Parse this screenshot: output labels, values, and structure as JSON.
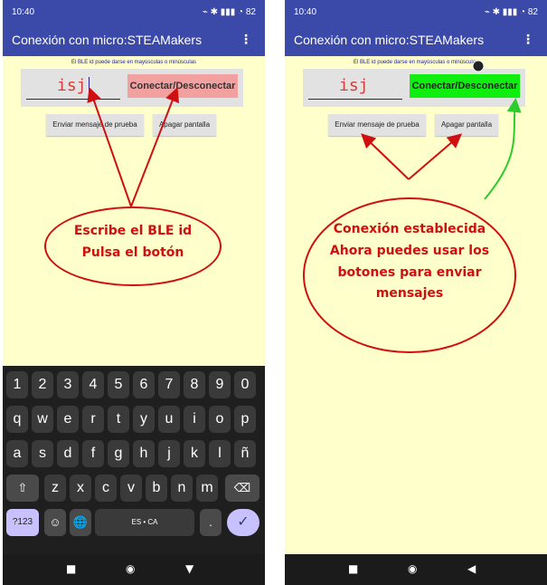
{
  "phones": [
    {
      "status": {
        "time": "10:40",
        "icons": "⌁ ✱ ▮▮▮ ◔ 82"
      },
      "appbar": {
        "title": "Conexión con micro:STEAMakers",
        "menu": "⋮"
      },
      "ble_hint": "El BLE id puede darse en mayúsculas o minúsculas",
      "ble_input_value": "isj",
      "connect_label": "Conectar/Desconectar",
      "test_button": "Enviar mensaje de prueba",
      "off_button": "Apagar pantalla",
      "annotation": {
        "line1": "Escribe el BLE id",
        "line2": "Pulsa el botón"
      },
      "keyboard": {
        "row1": [
          "1",
          "2",
          "3",
          "4",
          "5",
          "6",
          "7",
          "8",
          "9",
          "0"
        ],
        "row2": [
          "q",
          "w",
          "e",
          "r",
          "t",
          "y",
          "u",
          "i",
          "o",
          "p"
        ],
        "row3": [
          "a",
          "s",
          "d",
          "f",
          "g",
          "h",
          "j",
          "k",
          "l",
          "ñ"
        ],
        "row4": [
          "⇧",
          "z",
          "x",
          "c",
          "v",
          "b",
          "n",
          "m",
          "⌫"
        ],
        "row5": [
          "?123",
          "☺",
          "🌐",
          "ES • CA",
          ".",
          "✓"
        ]
      },
      "nav": [
        "■",
        "◉",
        "▼"
      ]
    },
    {
      "status": {
        "time": "10:40",
        "icons": "⌁ ✱ ▮▮▮ ◔ 82"
      },
      "appbar": {
        "title": "Conexión con micro:STEAMakers",
        "menu": "⋮"
      },
      "ble_hint": "El BLE id puede darse en mayúsculas o minúsculas",
      "ble_input_value": "isj",
      "connect_label": "Conectar/Desconectar",
      "test_button": "Enviar mensaje de prueba",
      "off_button": "Apagar pantalla",
      "annotation": {
        "line1": "Conexión establecida",
        "line2": "Ahora puedes usar los",
        "line3": "botones para enviar",
        "line4": "mensajes"
      },
      "nav": [
        "■",
        "◉",
        "◀"
      ]
    }
  ],
  "colors": {
    "appbar": "#3b4aa8",
    "content_bg": "#ffffcc",
    "connect_disconnected": "#f2a1a0",
    "connect_connected": "#10ee10",
    "annotation_red": "#d01010",
    "annotation_green": "#2dcc2d"
  }
}
